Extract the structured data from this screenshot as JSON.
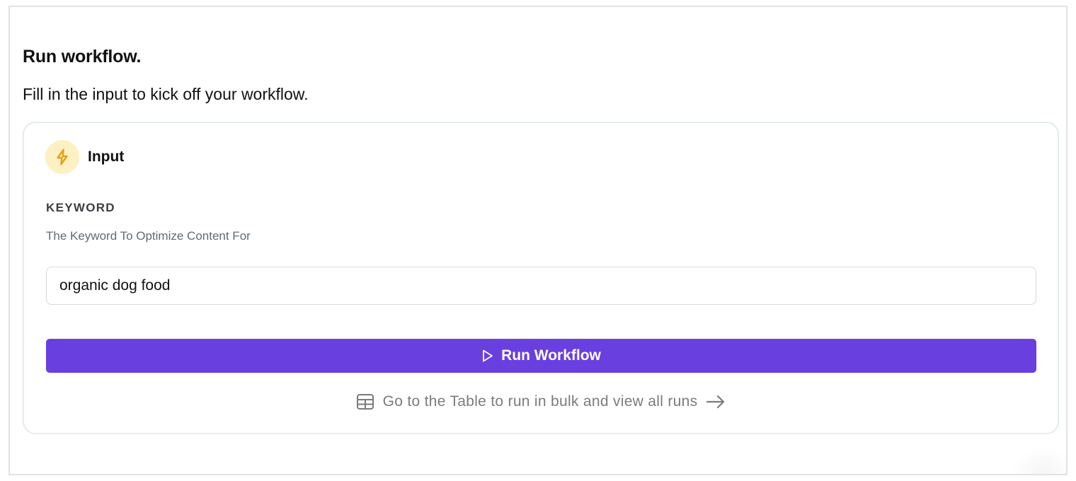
{
  "header": {
    "title": "Run workflow.",
    "subtitle": "Fill in the input to kick off your workflow."
  },
  "card": {
    "title": "Input",
    "title_icon": "bolt-icon",
    "field": {
      "label": "KEYWORD",
      "help": "The Keyword To Optimize Content For",
      "value": "organic dog food",
      "placeholder": ""
    },
    "run_button": {
      "label": "Run Workflow",
      "icon": "play-icon"
    },
    "table_link": {
      "label": "Go to the Table to run in bulk and view all runs",
      "leading_icon": "table-icon",
      "trailing_icon": "arrow-right-icon"
    }
  },
  "colors": {
    "accent": "#6a3fdf",
    "badge_bg": "#fdf0c2",
    "bolt": "#e0a21a",
    "card_border": "#e3ecef",
    "muted_text": "#7b7b7b"
  }
}
